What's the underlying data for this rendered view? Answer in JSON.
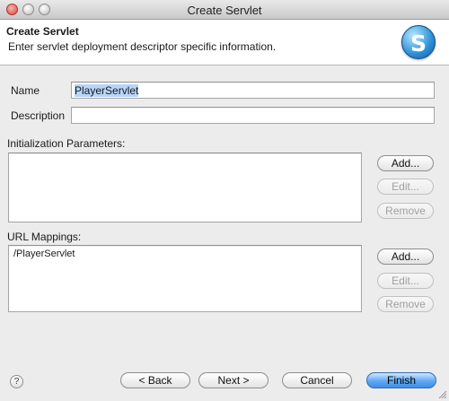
{
  "window": {
    "title": "Create Servlet"
  },
  "header": {
    "title": "Create Servlet",
    "description": "Enter servlet deployment descriptor specific information.",
    "logo_icon": "servlet-logo-icon",
    "logo_letter": "S"
  },
  "form": {
    "name_label": "Name",
    "name_value": "PlayerServlet",
    "description_label": "Description",
    "description_value": ""
  },
  "init_params": {
    "label": "Initialization Parameters:",
    "items": [],
    "add_label": "Add...",
    "edit_label": "Edit...",
    "remove_label": "Remove"
  },
  "url_mappings": {
    "label": "URL Mappings:",
    "items": [
      "/PlayerServlet"
    ],
    "add_label": "Add...",
    "edit_label": "Edit...",
    "remove_label": "Remove"
  },
  "footer": {
    "help_icon": "help-icon",
    "help_glyph": "?",
    "back_label": "< Back",
    "next_label": "Next >",
    "cancel_label": "Cancel",
    "finish_label": "Finish"
  },
  "colors": {
    "accent": "#3f8fe6",
    "selection": "#b6d5fb"
  }
}
